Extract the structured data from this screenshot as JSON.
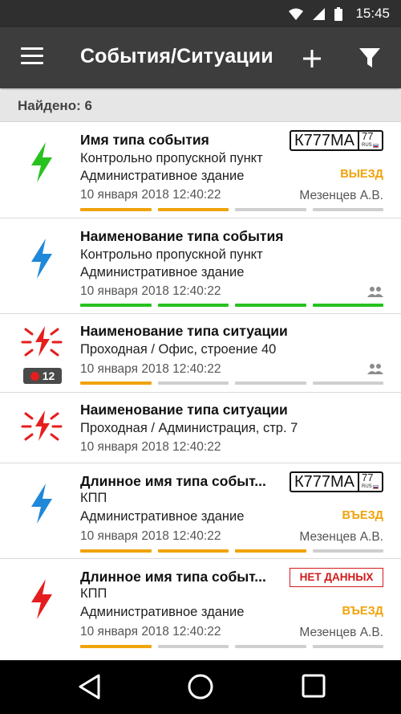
{
  "status_bar": {
    "time": "15:45",
    "icons": [
      "wifi-icon",
      "signal-icon",
      "battery-icon"
    ]
  },
  "app_bar": {
    "title": "События/Ситуации",
    "menu_icon": "menu-icon",
    "add_icon": "plus-icon",
    "filter_icon": "filter-icon"
  },
  "found": "Найдено: 6",
  "colors": {
    "green": "#27c21f",
    "blue": "#1f88d9",
    "red": "#e41e1e",
    "orange": "#f0a30a",
    "grey": "#cfcfcf"
  },
  "items": [
    {
      "type_name": "Имя типа события",
      "line2": "Контрольно пропускной пункт",
      "line3": "Административное здание",
      "date": "10 января 2018  12:40:22",
      "person": "Мезенцев А.В.",
      "status": "ВЫЕЗД",
      "plate": {
        "number": "К777МА",
        "region": "77",
        "country": "RUS"
      },
      "icon": "lightning-green-icon",
      "progress": [
        "orange",
        "orange",
        "grey",
        "grey"
      ]
    },
    {
      "type_name": "Наименование типа события",
      "line2": "Контрольно пропускной пункт",
      "line3": "Административное здание",
      "date": "10 января 2018  12:40:22",
      "icon": "lightning-blue-icon",
      "side_icon": "group-icon",
      "progress": [
        "green",
        "green",
        "green",
        "green"
      ]
    },
    {
      "type_name": "Наименование типа ситуации",
      "line2": "Проходная / Офис, строение 40",
      "date": "10 января 2018  12:40:22",
      "icon": "alarm-lightning-icon",
      "badge_count": "12",
      "side_icon": "group-icon",
      "progress": [
        "orange",
        "grey",
        "grey",
        "grey"
      ]
    },
    {
      "type_name": "Наименование типа ситуации",
      "line2": "Проходная / Администрация, стр. 7",
      "date": "10 января 2018  12:40:22",
      "icon": "alarm-lightning-icon"
    },
    {
      "type_name": "Длинное имя типа событ...",
      "line2": "КПП",
      "line3": "Административное здание",
      "date": "10 января 2018  12:40:22",
      "person": "Мезенцев А.В.",
      "status": "ВЪЕЗД",
      "plate": {
        "number": "К777МА",
        "region": "77",
        "country": "RUS"
      },
      "icon": "lightning-blue-icon",
      "progress": [
        "orange",
        "orange",
        "orange",
        "grey"
      ]
    },
    {
      "type_name": "Длинное имя типа событ...",
      "line2": "КПП",
      "line3": "Административное здание",
      "date": "10 января 2018  12:40:22",
      "person": "Мезенцев А.В.",
      "status": "ВЪЕЗД",
      "no_data": "НЕТ ДАННЫХ",
      "icon": "lightning-red-icon",
      "progress": [
        "orange",
        "grey",
        "grey",
        "grey"
      ]
    }
  ],
  "nav_bar": {
    "icons": [
      "back-icon",
      "home-icon",
      "recents-icon"
    ]
  }
}
